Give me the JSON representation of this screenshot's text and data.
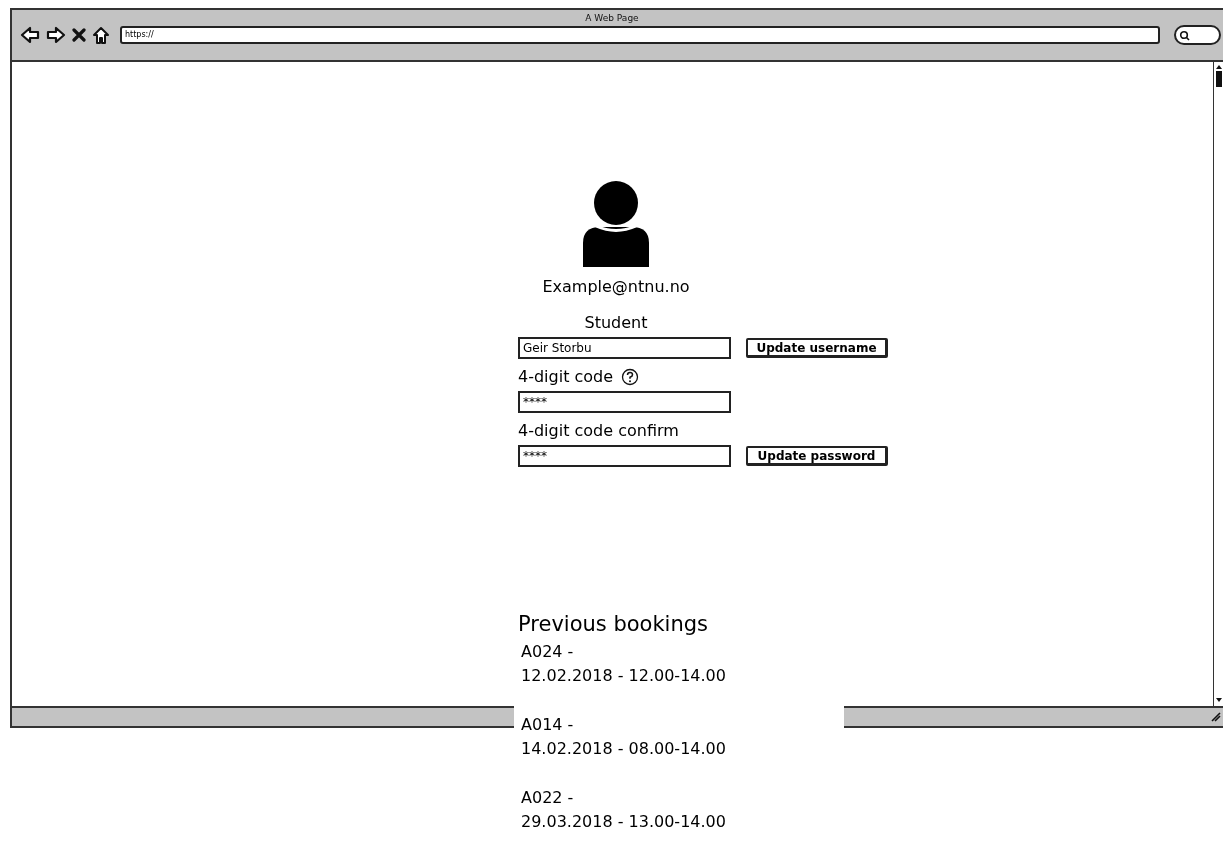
{
  "window": {
    "title": "A Web Page"
  },
  "address_bar": {
    "value": "https://"
  },
  "profile": {
    "email": "Example@ntnu.no",
    "role": "Student"
  },
  "form": {
    "username": {
      "value": "Geir Storbu"
    },
    "update_username_button": "Update username",
    "code_label": "4-digit code",
    "code": {
      "value": "****"
    },
    "confirm_label": "4-digit code confirm",
    "confirm": {
      "value": "****"
    },
    "update_password_button": "Update password"
  },
  "bookings": {
    "title": "Previous bookings",
    "items": [
      {
        "room": "A024 -",
        "when": "12.02.2018 - 12.00-14.00"
      },
      {
        "room": "A014 -",
        "when": "14.02.2018 - 08.00-14.00"
      },
      {
        "room": "A022 -",
        "when": "29.03.2018 - 13.00-14.00"
      }
    ]
  }
}
